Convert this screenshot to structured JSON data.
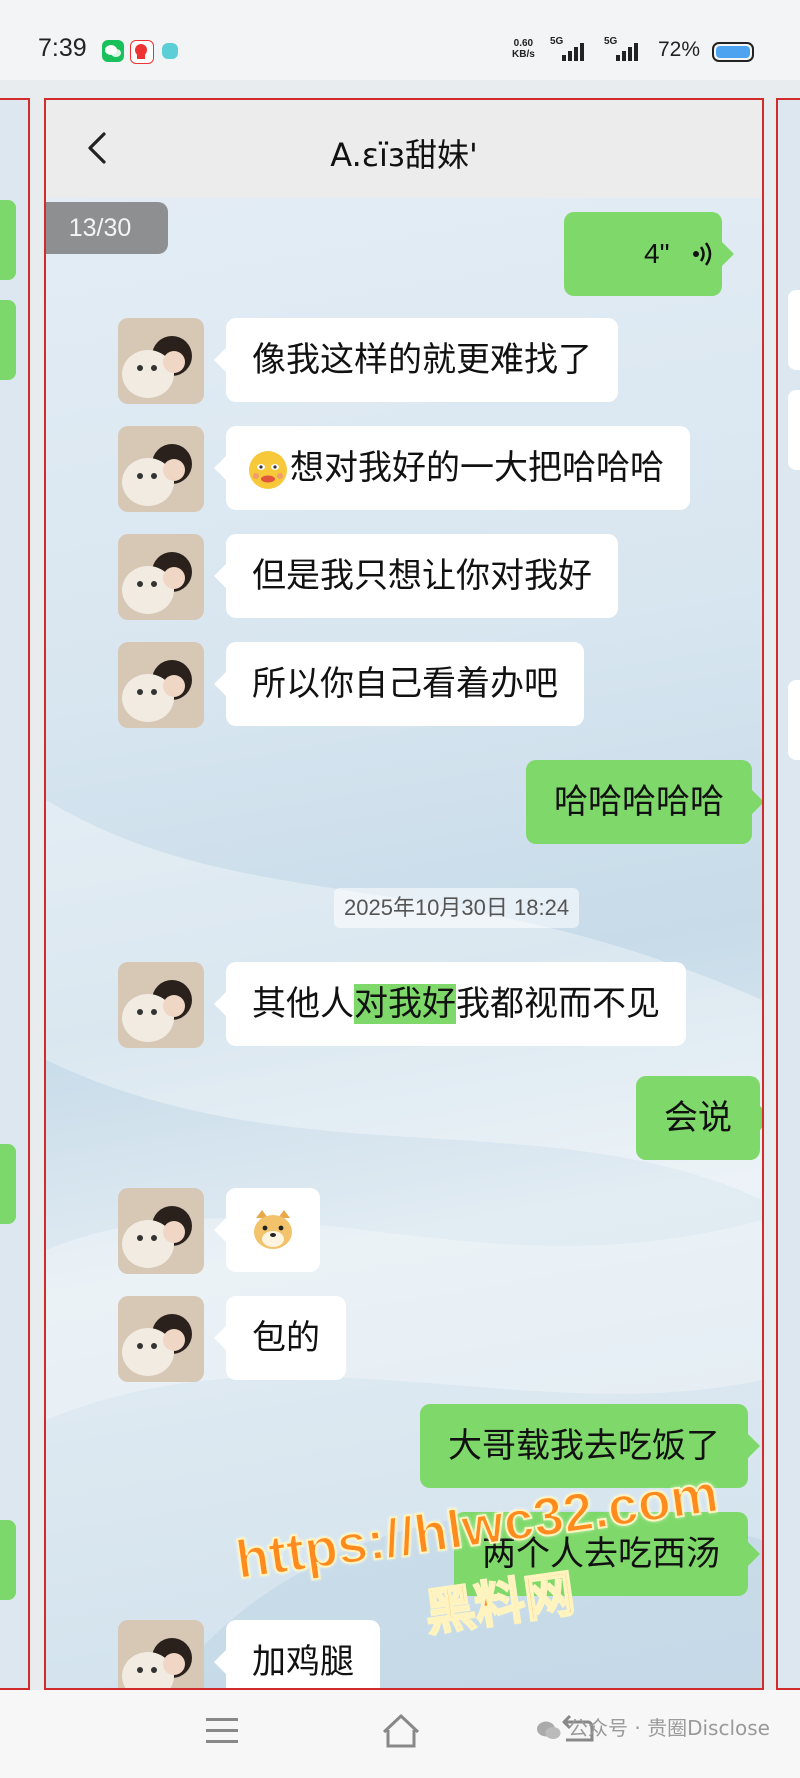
{
  "status_bar": {
    "time": "7:39",
    "net_rate_value": "0.60",
    "net_rate_unit": "KB/s",
    "signal1_label": "5G",
    "signal2_label": "5G",
    "battery": "72%"
  },
  "chat": {
    "title": "A.εïз甜妹'",
    "page_counter": "13/30",
    "timestamp": "2025年10月30日 18:24",
    "messages": [
      {
        "side": "out",
        "type": "voice",
        "text": "4\""
      },
      {
        "side": "in",
        "text": "像我这样的就更难找了"
      },
      {
        "side": "in",
        "text": "想对我好的一大把哈哈哈"
      },
      {
        "side": "in",
        "text": "但是我只想让你对我好"
      },
      {
        "side": "in",
        "text": "所以你自己看着办吧"
      },
      {
        "side": "out",
        "text": "哈哈哈哈哈"
      },
      {
        "side": "in",
        "text_before": "其他人",
        "text_highlight": "对我好",
        "text_after": "我都视而不见"
      },
      {
        "side": "out",
        "text": "会说"
      },
      {
        "side": "in",
        "type": "emoji",
        "text": ""
      },
      {
        "side": "in",
        "text": "包的"
      },
      {
        "side": "out",
        "text": "大哥载我去吃饭了"
      },
      {
        "side": "out",
        "text": "两个人去吃西汤"
      },
      {
        "side": "in",
        "text": "加鸡腿"
      }
    ]
  },
  "watermark": {
    "url": "https://hlwc32.com",
    "name": "黑料网"
  },
  "footer": {
    "source": "公众号 · 贵圈Disclose"
  },
  "colors": {
    "accent_green": "#7fd96a",
    "frame_red": "#d12b2b"
  }
}
